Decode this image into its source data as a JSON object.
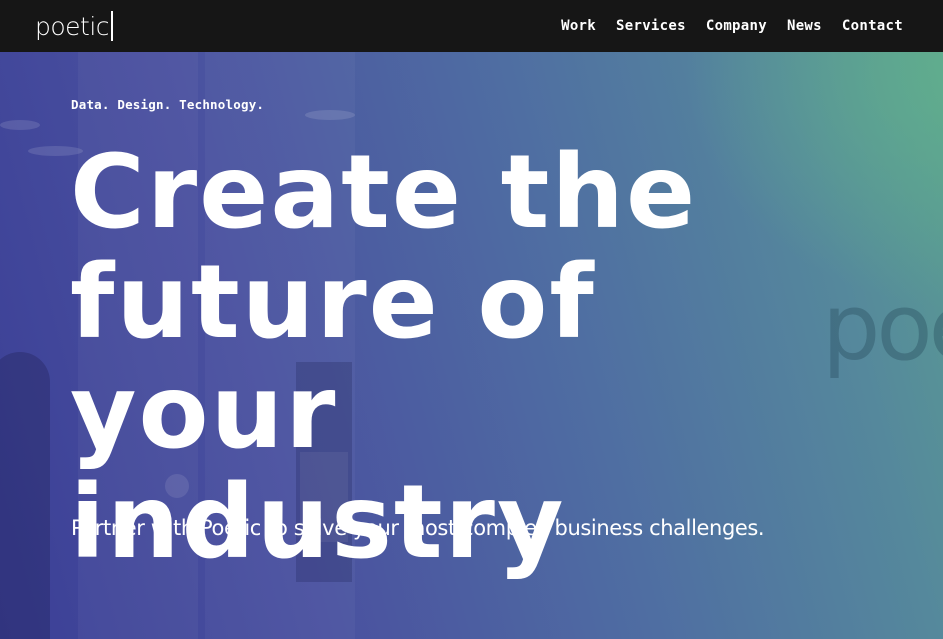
{
  "header": {
    "logo_text": "poetic",
    "nav": [
      {
        "label": "Work"
      },
      {
        "label": "Services"
      },
      {
        "label": "Company"
      },
      {
        "label": "News"
      },
      {
        "label": "Contact"
      }
    ]
  },
  "hero": {
    "eyebrow": "Data. Design. Technology.",
    "headline_lines": [
      "Create the",
      "future of your",
      "industry"
    ],
    "tagline": "Partner with Poetic to solve your most complex business challenges.",
    "background_watermark": "poe"
  },
  "colors": {
    "header_bg": "#161616",
    "gradient_purple": "#3b3f96",
    "gradient_teal": "#5a9c92",
    "text": "#ffffff"
  }
}
